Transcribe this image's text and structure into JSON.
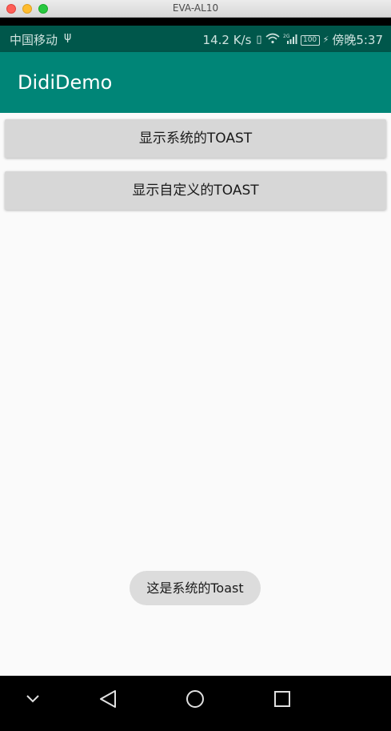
{
  "window": {
    "title": "EVA-AL10"
  },
  "status_bar": {
    "carrier": "中国移动",
    "usb_icon": "usb-icon",
    "speed": "14.2 K/s",
    "network": "2G",
    "battery": "100",
    "time": "傍晚5:37"
  },
  "app_bar": {
    "title": "DidiDemo"
  },
  "buttons": {
    "system_toast": "显示系统的TOAST",
    "custom_toast": "显示自定义的TOAST"
  },
  "toast": {
    "message": "这是系统的Toast"
  },
  "nav_bar": {
    "icons": [
      "chevron-down-icon",
      "back-icon",
      "home-icon",
      "recents-icon"
    ]
  },
  "colors": {
    "status_bar": "#00574b",
    "app_bar": "#008577",
    "background": "#fafafa",
    "button": "#d7d7d7"
  }
}
